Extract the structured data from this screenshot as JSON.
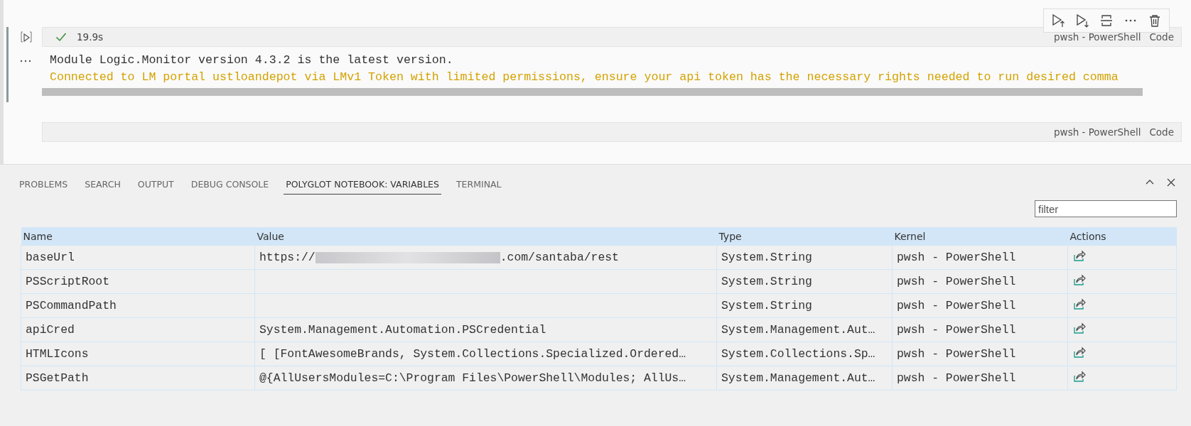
{
  "cell": {
    "status_ok": true,
    "duration": "19.9s",
    "language": "pwsh - PowerShell",
    "cell_type": "Code",
    "output": [
      {
        "text": "Module Logic.Monitor version 4.3.2 is the latest version.",
        "kind": "info"
      },
      {
        "text": "Connected to LM portal ustloandepot via LMv1 Token with limited permissions, ensure your api token has the necessary rights needed to run desired comma",
        "kind": "warning"
      }
    ]
  },
  "next_cell": {
    "language": "pwsh - PowerShell",
    "cell_type": "Code"
  },
  "panel": {
    "tabs": [
      {
        "label": "PROBLEMS",
        "selected": false
      },
      {
        "label": "SEARCH",
        "selected": false
      },
      {
        "label": "OUTPUT",
        "selected": false
      },
      {
        "label": "DEBUG CONSOLE",
        "selected": false
      },
      {
        "label": "POLYGLOT NOTEBOOK: VARIABLES",
        "selected": true
      },
      {
        "label": "TERMINAL",
        "selected": false
      }
    ],
    "filter": {
      "placeholder": "filter"
    },
    "table": {
      "columns": [
        "Name",
        "Value",
        "Type",
        "Kernel",
        "Actions"
      ],
      "rows": [
        {
          "name": "baseUrl",
          "value": "https://",
          "redacted": true,
          "value_suffix": ".com/santaba/rest",
          "type": "System.String",
          "kernel": "pwsh - PowerShell"
        },
        {
          "name": "PSScriptRoot",
          "type": "System.String",
          "kernel": "pwsh - PowerShell"
        },
        {
          "name": "PSCommandPath",
          "type": "System.String",
          "kernel": "pwsh - PowerShell"
        },
        {
          "name": "apiCred",
          "value": "System.Management.Automation.PSCredential",
          "type": "System.Management.Aut…",
          "kernel": "pwsh - PowerShell"
        },
        {
          "name": "HTMLIcons",
          "value": "[ [FontAwesomeBrands, System.Collections.Specialized.Ordered…",
          "type": "System.Collections.Sp…",
          "kernel": "pwsh - PowerShell"
        },
        {
          "name": "PSGetPath",
          "value": "@{AllUsersModules=C:\\Program Files\\PowerShell\\Modules; AllUs…",
          "type": "System.Management.Aut…",
          "kernel": "pwsh - PowerShell"
        }
      ]
    }
  }
}
